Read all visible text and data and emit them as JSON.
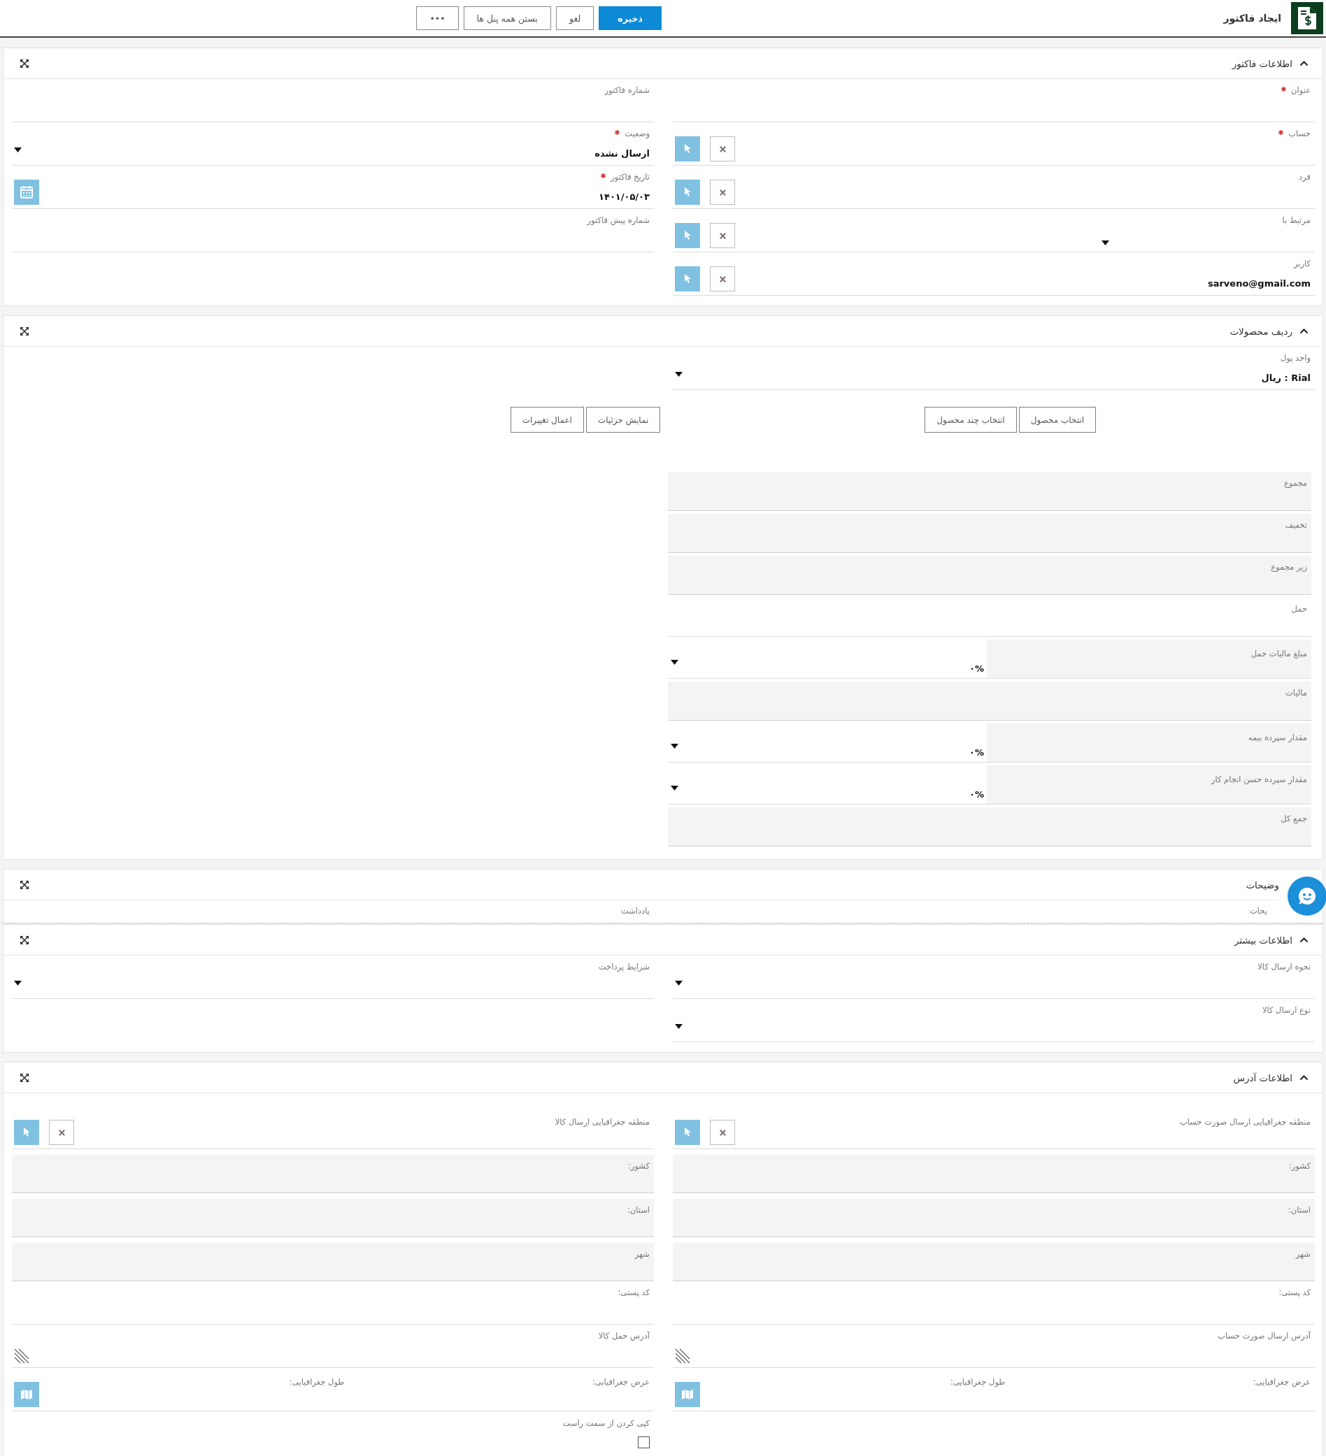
{
  "top_bar": {
    "title": "ایجاد فاکتور",
    "buttons": [
      {
        "label": "ذخیره",
        "kind": "primary"
      },
      {
        "label": "لغو",
        "kind": "plain"
      },
      {
        "label": "بستن همه پنل ها",
        "kind": "plain"
      },
      {
        "label": "•••",
        "kind": "plain"
      }
    ]
  },
  "sections": [
    {
      "kind": "form",
      "title": "اطلاعات فاکتور",
      "expanded": true,
      "right": [
        {
          "kind": "text",
          "label": "عنوان",
          "required": true
        },
        {
          "kind": "lookup",
          "label": "حساب",
          "required": true
        },
        {
          "kind": "lookup",
          "label": "فرد",
          "required": false
        },
        {
          "kind": "lookup_dropdown",
          "label": "مرتبط با",
          "required": false
        },
        {
          "kind": "lookup",
          "label": "کاربر",
          "required": false,
          "value": "sarveno@gmail.com"
        }
      ],
      "left": [
        {
          "kind": "text",
          "label": "شماره فاکتور",
          "required": false
        },
        {
          "kind": "dropdown",
          "label": "وضعیت",
          "required": true,
          "value": "ارسال نشده"
        },
        {
          "kind": "date",
          "label": "تاریخ فاکتور",
          "required": true,
          "value": "۱۴۰۱/۰۵/۰۳"
        },
        {
          "kind": "text",
          "label": "شماره پیش فاکتور",
          "required": false
        }
      ]
    },
    {
      "kind": "products",
      "title": "ردیف محصولات",
      "expanded": true,
      "currency": {
        "kind": "dropdown",
        "label": "واحد پول",
        "value": "Rial : ریال"
      },
      "action_groups": [
        [
          "انتخاب محصول",
          "انتخاب چند محصول"
        ],
        [
          "نمایش جزئیات",
          "اعمال تغییرات"
        ]
      ],
      "totals": [
        {
          "kind": "readonly",
          "label": "مجموع"
        },
        {
          "kind": "readonly",
          "label": "تخفیف"
        },
        {
          "kind": "readonly",
          "label": "زیر مجموع"
        },
        {
          "kind": "text",
          "label": "حمل"
        },
        {
          "kind": "percent",
          "label": "مبلغ مالیات حمل",
          "value": "۰%"
        },
        {
          "kind": "readonly",
          "label": "مالیات"
        },
        {
          "kind": "percent",
          "label": "مقدار سپرده بیمه",
          "value": "۰%"
        },
        {
          "kind": "percent",
          "label": "مقدار سپرده حسن انجام کار",
          "value": "۰%"
        },
        {
          "kind": "readonly",
          "label": "جمع کل"
        }
      ]
    },
    {
      "kind": "notes",
      "title": "وضیحات",
      "right": [
        {
          "kind": "text",
          "label": "یحات"
        }
      ],
      "left": [
        {
          "kind": "text",
          "label": "یادداشت"
        }
      ]
    },
    {
      "kind": "form",
      "title": "اطلاعات بیشتر",
      "expanded": true,
      "right": [
        {
          "kind": "dropdown",
          "label": "نحوه ارسال کالا"
        },
        {
          "kind": "dropdown",
          "label": "نوع ارسال کالا"
        }
      ],
      "left": [
        {
          "kind": "dropdown",
          "label": "شرایط پرداخت"
        }
      ]
    },
    {
      "kind": "form",
      "title": "اطلاعات آدرس",
      "expanded": true,
      "right": [
        {
          "kind": "lookup",
          "label": "منطقه جغرافیایی ارسال صورت حساب"
        },
        {
          "kind": "readonly",
          "label": "کشور:"
        },
        {
          "kind": "readonly",
          "label": "استان:"
        },
        {
          "kind": "readonly",
          "label": "شهر"
        },
        {
          "kind": "text",
          "label": "کد پستی:"
        },
        {
          "kind": "textarea",
          "label": "آدرس ارسال صورت حساب"
        },
        {
          "kind": "geo",
          "latitude_label": "عرض جغرافیایی:",
          "longitude_label": "طول جغرافیایی:"
        }
      ],
      "left": [
        {
          "kind": "lookup",
          "label": "منطقه جغرافیایی ارسال کالا"
        },
        {
          "kind": "readonly",
          "label": "کشور:"
        },
        {
          "kind": "readonly",
          "label": "استان:"
        },
        {
          "kind": "readonly",
          "label": "شهر"
        },
        {
          "kind": "text",
          "label": "کد پستی:"
        },
        {
          "kind": "textarea",
          "label": "آدرس حمل کالا"
        },
        {
          "kind": "geo",
          "latitude_label": "عرض جغرافیایی:",
          "longitude_label": "طول جغرافیایی:"
        },
        {
          "kind": "checkbox",
          "label": "کپی کردن از سمت راست",
          "checked": false
        }
      ]
    }
  ]
}
